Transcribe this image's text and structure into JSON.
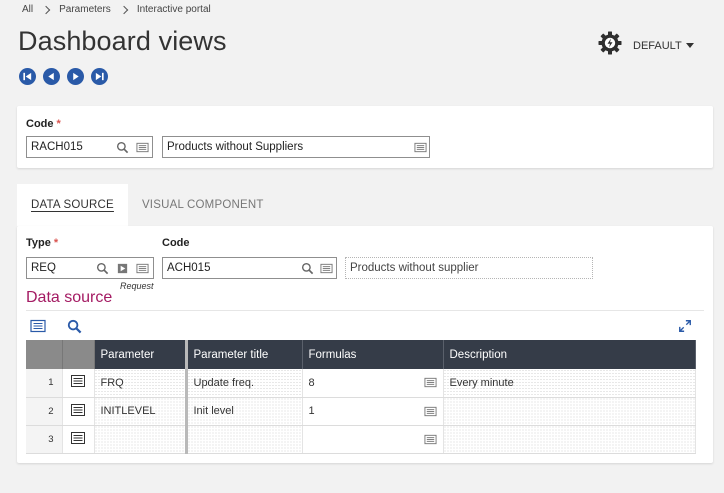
{
  "breadcrumb": [
    "All",
    "Parameters",
    "Interactive portal"
  ],
  "page_title": "Dashboard views",
  "top_right": {
    "default_label": "DEFAULT"
  },
  "code_field": {
    "label": "Code",
    "required_mark": "*",
    "value": "RACH015",
    "description": "Products without Suppliers"
  },
  "tabs": [
    {
      "label": "DATA SOURCE",
      "active": true
    },
    {
      "label": "VISUAL COMPONENT",
      "active": false
    }
  ],
  "data_source": {
    "type_label": "Type",
    "required_mark": "*",
    "type_value": "REQ",
    "request_label": "Request",
    "code_label": "Code",
    "code_value": "ACH015",
    "code_description": "Products without supplier",
    "section_title": "Data source"
  },
  "grid": {
    "columns": [
      "",
      "",
      "Parameter",
      "Parameter title",
      "Formulas",
      "Description"
    ],
    "rows": [
      {
        "num": "1",
        "parameter": "FRQ",
        "title": "Update freq.",
        "formula": "8",
        "description": "Every minute"
      },
      {
        "num": "2",
        "parameter": "INITLEVEL",
        "title": "Init level",
        "formula": "1",
        "description": ""
      },
      {
        "num": "3",
        "parameter": "",
        "title": "",
        "formula": "",
        "description": ""
      }
    ]
  },
  "colors": {
    "accent_blue": "#2a5aa8",
    "section_title": "#a41b63",
    "header_dark": "#353c48",
    "required": "#d9534f"
  }
}
